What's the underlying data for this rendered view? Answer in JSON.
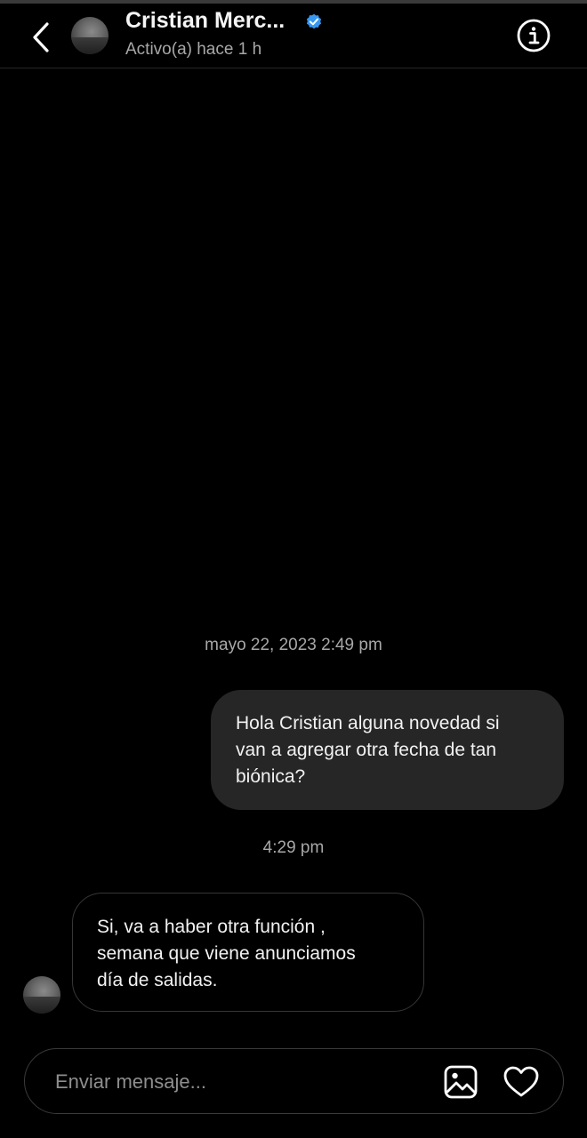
{
  "header": {
    "contact_name": "Cristian Merc...",
    "status": "Activo(a) hace 1 h",
    "back_icon": "chevron-left-icon",
    "info_icon": "info-icon",
    "verified_color": "#3897f0"
  },
  "messages": {
    "timestamp_1": "mayo 22, 2023 2:49 pm",
    "sent_1": "Hola Cristian alguna novedad si\nvan a agregar otra fecha de tan\nbiónica?",
    "timestamp_2": "4:29 pm",
    "received_1": "Si, va a haber otra función ,\nsemana que viene anunciamos\ndía de salidas."
  },
  "composer": {
    "placeholder": "Enviar mensaje...",
    "gallery_icon": "image-icon",
    "like_icon": "heart-icon"
  },
  "colors": {
    "background": "#000000",
    "sent_bubble": "#262626",
    "secondary_text": "#a8a8a8"
  }
}
